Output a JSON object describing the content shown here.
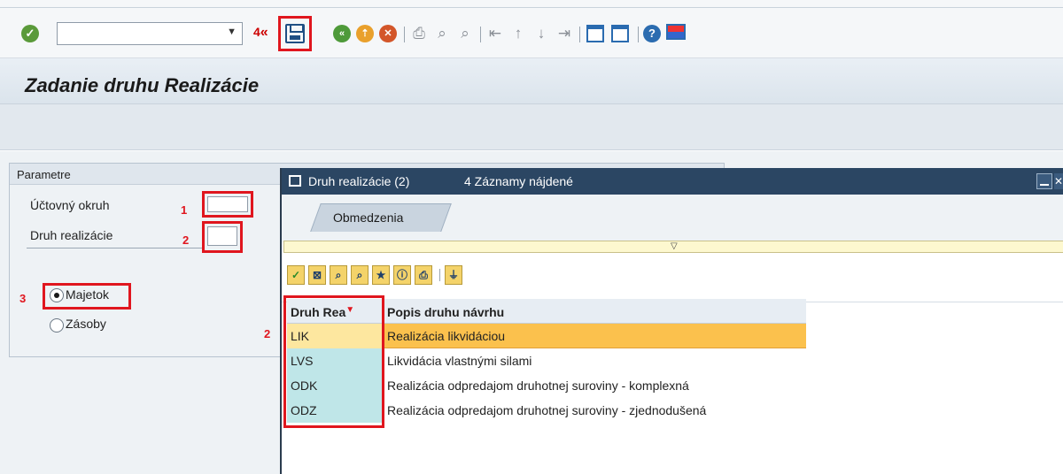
{
  "toolbar": {
    "command_field": "",
    "history_arrow": "«",
    "annotation_4": "4"
  },
  "screen": {
    "title": "Zadanie druhu Realizácie"
  },
  "params": {
    "panel_title": "Parametre",
    "account_label": "Účtovný okruh",
    "account_value": "",
    "account_mark": "1",
    "type_label": "Druh realizácie",
    "type_value": "",
    "type_mark": "2",
    "radio_mark": "3",
    "radio_asset": "Majetok",
    "radio_stock": "Zásoby",
    "grid_mark": "2"
  },
  "dialog": {
    "title": "Druh realizácie (2)",
    "count": "4 Záznamy nájdené",
    "tab": "Obmedzenia",
    "columns": [
      "Druh Rea",
      "Popis druhu návrhu"
    ],
    "rows": [
      {
        "code": "LIK",
        "desc": "Realizácia likvidáciou"
      },
      {
        "code": "LVS",
        "desc": "Likvidácia vlastnými silami"
      },
      {
        "code": "ODK",
        "desc": "Realizácia odpredajom druhotnej suroviny - komplexná"
      },
      {
        "code": "ODZ",
        "desc": "Realizácia odpredajom druhotnej suroviny - zjednodušená"
      }
    ]
  },
  "colors": {
    "accent": "#e0161e",
    "dialog_title": "#2b4663",
    "selected_row": "#fbc14d"
  }
}
